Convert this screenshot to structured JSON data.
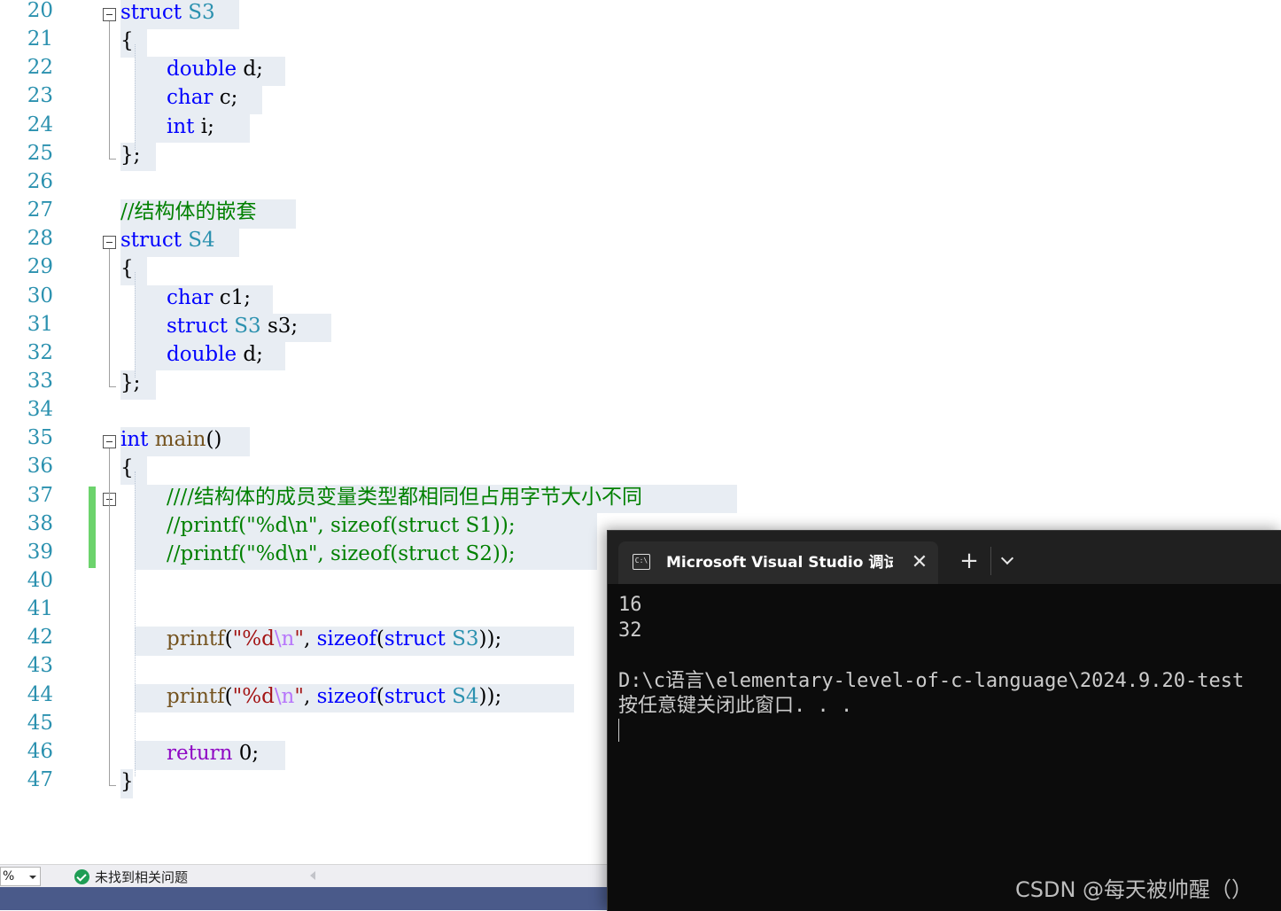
{
  "editor": {
    "line_numbers": [
      "20",
      "21",
      "22",
      "23",
      "24",
      "25",
      "26",
      "27",
      "28",
      "29",
      "30",
      "31",
      "32",
      "33",
      "34",
      "35",
      "36",
      "37",
      "38",
      "39",
      "40",
      "41",
      "42",
      "43",
      "44",
      "45",
      "46",
      "47"
    ],
    "lines": [
      {
        "ln": "20",
        "tokens": [
          {
            "c": "kw",
            "t": "struct"
          },
          {
            "c": "tx",
            "t": " "
          },
          {
            "c": "ty",
            "t": "S3"
          }
        ]
      },
      {
        "ln": "21",
        "tokens": [
          {
            "c": "tx",
            "t": "{"
          }
        ]
      },
      {
        "ln": "22",
        "tokens": [
          {
            "c": "kw",
            "t": "double"
          },
          {
            "c": "tx",
            "t": " d;"
          }
        ]
      },
      {
        "ln": "23",
        "tokens": [
          {
            "c": "kw",
            "t": "char"
          },
          {
            "c": "tx",
            "t": " c;"
          }
        ]
      },
      {
        "ln": "24",
        "tokens": [
          {
            "c": "kw",
            "t": "int"
          },
          {
            "c": "tx",
            "t": " i;"
          }
        ]
      },
      {
        "ln": "25",
        "tokens": [
          {
            "c": "tx",
            "t": "};"
          }
        ]
      },
      {
        "ln": "26",
        "tokens": []
      },
      {
        "ln": "27",
        "tokens": [
          {
            "c": "cm",
            "t": "//结构体的嵌套"
          }
        ]
      },
      {
        "ln": "28",
        "tokens": [
          {
            "c": "kw",
            "t": "struct"
          },
          {
            "c": "tx",
            "t": " "
          },
          {
            "c": "ty",
            "t": "S4"
          }
        ]
      },
      {
        "ln": "29",
        "tokens": [
          {
            "c": "tx",
            "t": "{"
          }
        ]
      },
      {
        "ln": "30",
        "tokens": [
          {
            "c": "kw",
            "t": "char"
          },
          {
            "c": "tx",
            "t": " c1;"
          }
        ]
      },
      {
        "ln": "31",
        "tokens": [
          {
            "c": "kw",
            "t": "struct"
          },
          {
            "c": "tx",
            "t": " "
          },
          {
            "c": "ty",
            "t": "S3"
          },
          {
            "c": "tx",
            "t": " s3;"
          }
        ]
      },
      {
        "ln": "32",
        "tokens": [
          {
            "c": "kw",
            "t": "double"
          },
          {
            "c": "tx",
            "t": " d;"
          }
        ]
      },
      {
        "ln": "33",
        "tokens": [
          {
            "c": "tx",
            "t": "};"
          }
        ]
      },
      {
        "ln": "34",
        "tokens": []
      },
      {
        "ln": "35",
        "tokens": [
          {
            "c": "kw",
            "t": "int"
          },
          {
            "c": "tx",
            "t": " "
          },
          {
            "c": "fn",
            "t": "main"
          },
          {
            "c": "tx",
            "t": "()"
          }
        ]
      },
      {
        "ln": "36",
        "tokens": [
          {
            "c": "tx",
            "t": "{"
          }
        ]
      },
      {
        "ln": "37",
        "tokens": [
          {
            "c": "cm",
            "t": "////结构体的成员变量类型都相同但占用字节大小不同"
          }
        ]
      },
      {
        "ln": "38",
        "tokens": [
          {
            "c": "cm",
            "t": "//printf(\"%d\\n\", sizeof(struct S1));"
          }
        ]
      },
      {
        "ln": "39",
        "tokens": [
          {
            "c": "cm",
            "t": "//printf(\"%d\\n\", sizeof(struct S2));"
          }
        ]
      },
      {
        "ln": "40",
        "tokens": []
      },
      {
        "ln": "41",
        "tokens": []
      },
      {
        "ln": "42",
        "tokens": [
          {
            "c": "fn",
            "t": "printf"
          },
          {
            "c": "tx",
            "t": "("
          },
          {
            "c": "st",
            "t": "\"%d"
          },
          {
            "c": "esc",
            "t": "\\n"
          },
          {
            "c": "st",
            "t": "\""
          },
          {
            "c": "tx",
            "t": ", "
          },
          {
            "c": "kw",
            "t": "sizeof"
          },
          {
            "c": "tx",
            "t": "("
          },
          {
            "c": "kw",
            "t": "struct"
          },
          {
            "c": "tx",
            "t": " "
          },
          {
            "c": "ty",
            "t": "S3"
          },
          {
            "c": "tx",
            "t": "));"
          }
        ]
      },
      {
        "ln": "43",
        "tokens": []
      },
      {
        "ln": "44",
        "tokens": [
          {
            "c": "fn",
            "t": "printf"
          },
          {
            "c": "tx",
            "t": "("
          },
          {
            "c": "st",
            "t": "\"%d"
          },
          {
            "c": "esc",
            "t": "\\n"
          },
          {
            "c": "st",
            "t": "\""
          },
          {
            "c": "tx",
            "t": ", "
          },
          {
            "c": "kw",
            "t": "sizeof"
          },
          {
            "c": "tx",
            "t": "("
          },
          {
            "c": "kw",
            "t": "struct"
          },
          {
            "c": "tx",
            "t": " "
          },
          {
            "c": "ty",
            "t": "S4"
          },
          {
            "c": "tx",
            "t": "));"
          }
        ]
      },
      {
        "ln": "45",
        "tokens": []
      },
      {
        "ln": "46",
        "tokens": [
          {
            "c": "ctl",
            "t": "return"
          },
          {
            "c": "tx",
            "t": " 0;"
          }
        ]
      },
      {
        "ln": "47",
        "tokens": [
          {
            "c": "tx",
            "t": "}"
          }
        ]
      }
    ]
  },
  "statusbar": {
    "zoom": "%",
    "issues_text": "未找到相关问题"
  },
  "terminal": {
    "tab_title": "Microsoft Visual Studio 调试控制台",
    "close_glyph": "✕",
    "new_tab_glyph": "+",
    "icon_text": "C:\\",
    "output_lines": [
      "16",
      "32",
      "",
      "D:\\c语言\\elementary-level-of-c-language\\2024.9.20-test",
      "按任意键关闭此窗口. . ."
    ]
  },
  "watermark": "CSDN @每天被帅醒（）",
  "colors": {
    "keyword": "#0000ff",
    "type": "#2b91af",
    "comment": "#008000",
    "function": "#74531f",
    "control": "#8f08c4",
    "string": "#a31515",
    "line_number": "#2b91af",
    "change_bar": "#6cd36c"
  }
}
